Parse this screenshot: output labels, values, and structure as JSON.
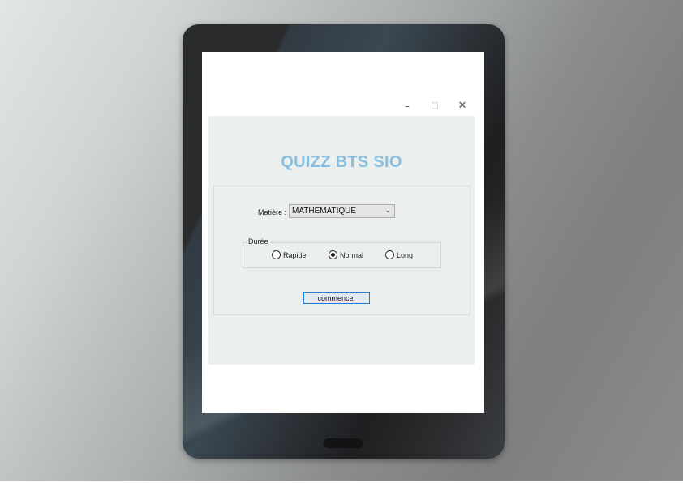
{
  "window": {
    "minimize_glyph": "–",
    "maximize_glyph": "□",
    "close_glyph": "✕"
  },
  "app": {
    "title": "QUIZZ BTS SIO"
  },
  "form": {
    "matiere_label": "Matière :",
    "matiere_value": "MATHEMATIQUE",
    "chevron_glyph": "⌄",
    "duree_label": "Durée",
    "options": [
      {
        "label": "Rapide",
        "checked": false
      },
      {
        "label": "Normal",
        "checked": true
      },
      {
        "label": "Long",
        "checked": false
      }
    ],
    "start_button": "commencer"
  },
  "colors": {
    "title": "#87bfe0",
    "client_background": "#ebf0ef",
    "button_border": "#1a7dd7"
  },
  "icons": [
    "minimize-icon",
    "maximize-icon",
    "close-icon",
    "chevron-down-icon"
  ]
}
